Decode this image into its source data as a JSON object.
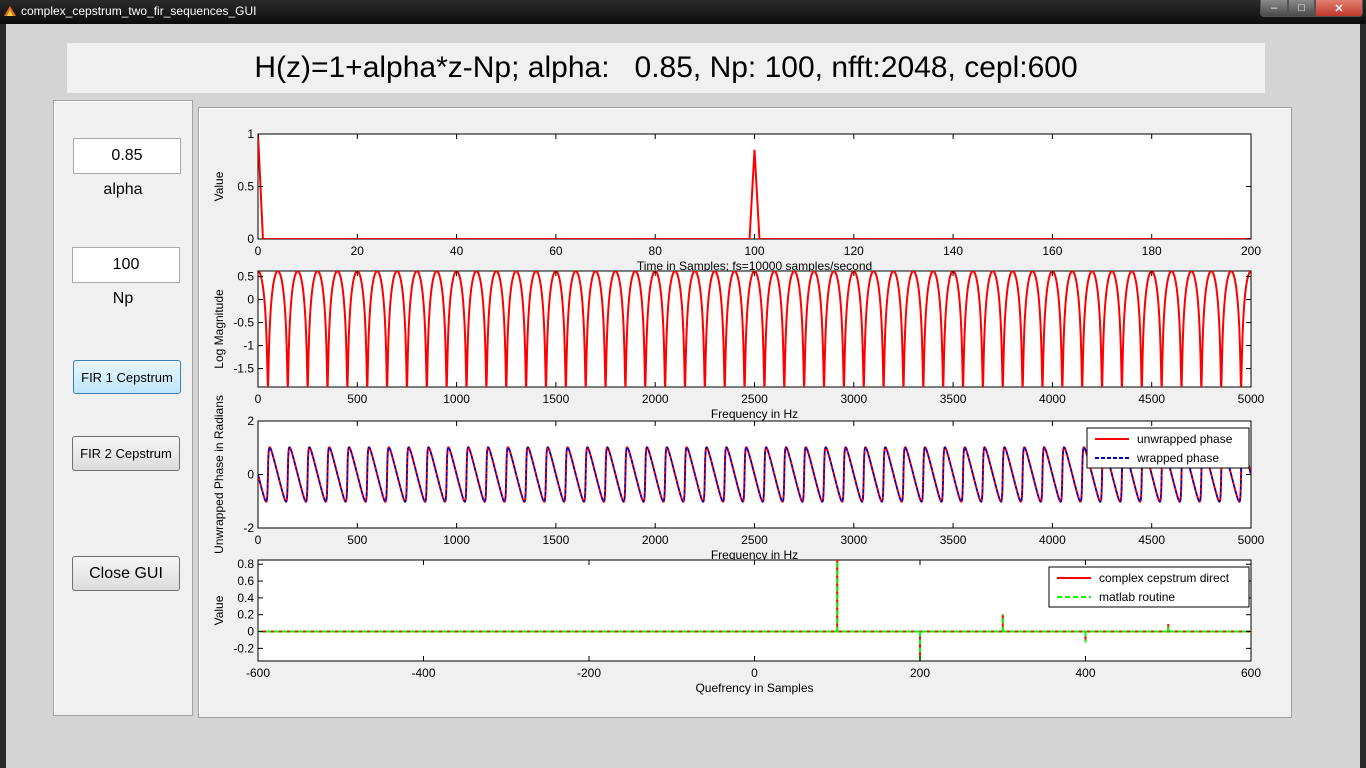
{
  "window": {
    "title": "complex_cepstrum_two_fir_sequences_GUI",
    "min_glyph": "–",
    "max_glyph": "□",
    "close_glyph": "✕"
  },
  "header": {
    "text": "H(z)=1+alpha*z-Np; alpha:   0.85, Np: 100, nfft:2048, cepl:600"
  },
  "controls": {
    "alpha_value": "0.85",
    "alpha_label": "alpha",
    "np_value": "100",
    "np_label": "Np",
    "fir1_button": "FIR 1 Cepstrum",
    "fir2_button": "FIR 2 Cepstrum",
    "close_button": "Close GUI"
  },
  "colors": {
    "red": "#ff0000",
    "blue": "#0000cc",
    "green": "#00ff00"
  },
  "chart_data": [
    {
      "type": "line",
      "ylabel": "Value",
      "xlabel": "Time in Samples; fs=10000 samples/second",
      "xlim": [
        0,
        200
      ],
      "ylim": [
        0,
        1
      ],
      "xticks": [
        0,
        20,
        40,
        60,
        80,
        100,
        120,
        140,
        160,
        180,
        200
      ],
      "yticks": [
        0,
        0.5,
        1
      ],
      "series": [
        {
          "x": [
            0,
            100
          ],
          "y": [
            1,
            0.85
          ]
        }
      ]
    },
    {
      "type": "line",
      "ylabel": "Log Magnitude",
      "xlabel": "Frequency in Hz",
      "xlim": [
        0,
        5000
      ],
      "ylim": [
        -1.9,
        0.62
      ],
      "xticks": [
        0,
        500,
        1000,
        1500,
        2000,
        2500,
        3000,
        3500,
        4000,
        4500,
        5000
      ],
      "yticks": [
        0.5,
        0,
        -0.5,
        -1,
        -1.5
      ],
      "params": {
        "alpha": 0.85,
        "Np": 100,
        "fs": 10000
      }
    },
    {
      "type": "line",
      "ylabel": "Unwrapped Phase in Radians",
      "xlabel": "Frequency in Hz",
      "xlim": [
        0,
        5000
      ],
      "ylim": [
        -2,
        2
      ],
      "xticks": [
        0,
        500,
        1000,
        1500,
        2000,
        2500,
        3000,
        3500,
        4000,
        4500,
        5000
      ],
      "yticks": [
        -2,
        0,
        2
      ],
      "legend": {
        "position": "top-right",
        "entries": [
          "unwrapped phase",
          "wrapped phase"
        ]
      },
      "params": {
        "alpha": 0.85,
        "Np": 100,
        "fs": 10000
      }
    },
    {
      "type": "line",
      "ylabel": "Value",
      "xlabel": "Quefrency in Samples",
      "xlim": [
        -600,
        600
      ],
      "ylim": [
        -0.35,
        0.85
      ],
      "xticks": [
        -600,
        -400,
        -200,
        0,
        200,
        400,
        600
      ],
      "yticks": [
        -0.2,
        0,
        0.2,
        0.4,
        0.6,
        0.8
      ],
      "legend": {
        "position": "top-right",
        "entries": [
          "complex cepstrum direct",
          "matlab routine"
        ]
      },
      "series": [
        {
          "x": [
            100,
            200,
            300,
            400,
            500
          ],
          "y": [
            0.85,
            -0.361,
            0.205,
            -0.13,
            0.089
          ]
        }
      ]
    }
  ]
}
